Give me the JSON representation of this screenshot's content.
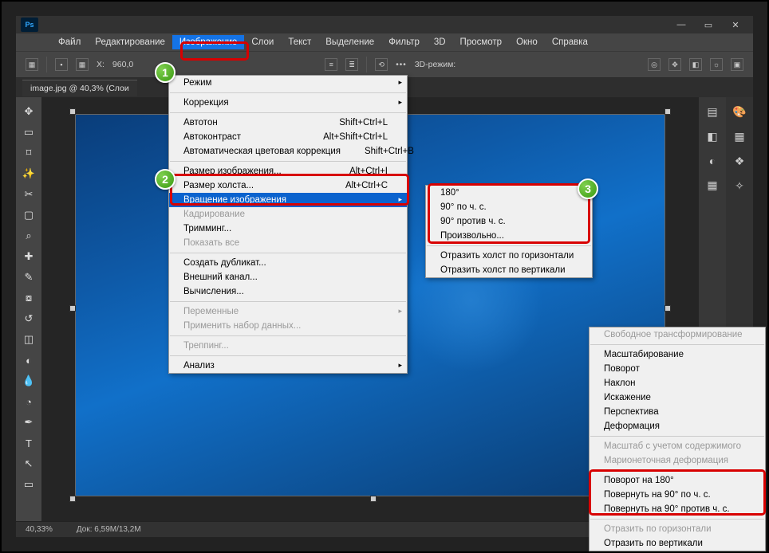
{
  "app": {
    "ps_badge": "Ps"
  },
  "menubar": [
    "Файл",
    "Редактирование",
    "Изображение",
    "Слои",
    "Текст",
    "Выделение",
    "Фильтр",
    "3D",
    "Просмотр",
    "Окно",
    "Справка"
  ],
  "active_menu_index": 2,
  "optionbar": {
    "x_label": "X:",
    "x_value": "960,0",
    "mode_label": "3D-режим:"
  },
  "doc_tab": "image.jpg @ 40,3% (Слои",
  "status": {
    "zoom": "40,33%",
    "doc": "Док: 6,59M/13,2M"
  },
  "image_menu": {
    "row_hidden_top": "Режим",
    "correction": "Коррекция",
    "autotone": {
      "label": "Автотон",
      "short": "Shift+Ctrl+L"
    },
    "autocontrast": {
      "label": "Автоконтраст",
      "short": "Alt+Shift+Ctrl+L"
    },
    "autocolor": {
      "label": "Автоматическая цветовая коррекция",
      "short": "Shift+Ctrl+B"
    },
    "imgsize": {
      "label": "Размер изображения...",
      "short": "Alt+Ctrl+I"
    },
    "canvassize": {
      "label": "Размер холста...",
      "short": "Alt+Ctrl+C"
    },
    "rotate": "Вращение изображения",
    "crop": "Кадрирование",
    "trim": "Тримминг...",
    "reveal": "Показать все",
    "dup": "Создать дубликат...",
    "extchan": "Внешний канал...",
    "calc": "Вычисления...",
    "vars": "Переменные",
    "applyds": "Применить набор данных...",
    "trap": "Треппинг...",
    "analysis": "Анализ"
  },
  "rotate_sub": {
    "r180": "180°",
    "r90cw": "90° по ч. с.",
    "r90ccw": "90° против ч. с.",
    "arb": "Произвольно...",
    "fliph": "Отразить холст по горизонтали",
    "flipv": "Отразить холст по вертикали"
  },
  "ctx_menu": {
    "free": "Свободное трансформирование",
    "scale": "Масштабирование",
    "rotate": "Поворот",
    "skew": "Наклон",
    "distort": "Искажение",
    "persp": "Перспектива",
    "warp": "Деформация",
    "content": "Масштаб с учетом содержимого",
    "puppet": "Марионеточная деформация",
    "r180": "Поворот на 180°",
    "r90cw": "Повернуть на 90° по ч. с.",
    "r90ccw": "Повернуть на 90° против ч. с.",
    "fliph": "Отразить по горизонтали",
    "flipv": "Отразить по вертикали"
  },
  "badges": {
    "b1": "1",
    "b2": "2",
    "b3": "3"
  }
}
